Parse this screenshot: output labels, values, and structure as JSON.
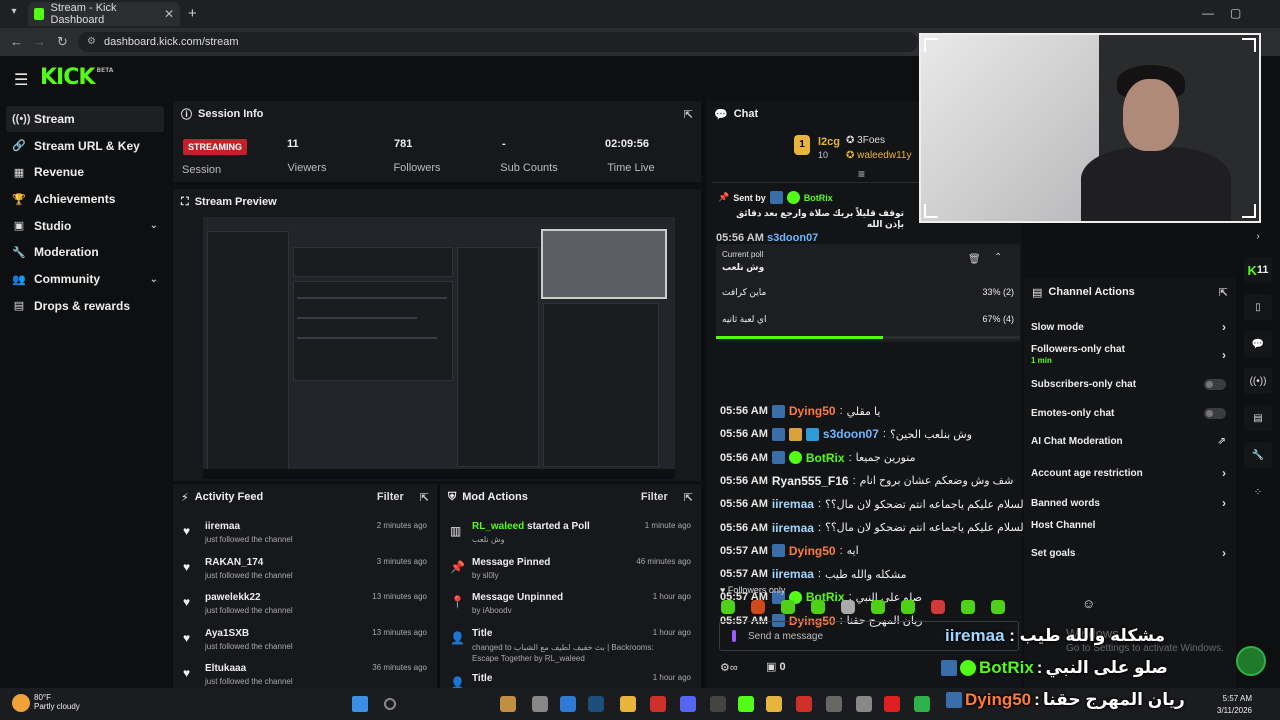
{
  "browser": {
    "tab_title": "Stream - Kick Dashboard",
    "url": "dashboard.kick.com/stream"
  },
  "app": {
    "logo": "KICK",
    "logo_tag": "BETA"
  },
  "sidebar": {
    "items": [
      {
        "label": "Stream",
        "icon": "signal-icon"
      },
      {
        "label": "Stream URL & Key",
        "icon": "link-icon"
      },
      {
        "label": "Revenue",
        "icon": "revenue-icon"
      },
      {
        "label": "Achievements",
        "icon": "trophy-icon"
      },
      {
        "label": "Studio",
        "icon": "studio-icon"
      },
      {
        "label": "Moderation",
        "icon": "wrench-icon"
      },
      {
        "label": "Community",
        "icon": "people-icon"
      },
      {
        "label": "Drops & rewards",
        "icon": "drops-icon"
      }
    ]
  },
  "session": {
    "title": "Session Info",
    "status_badge": "STREAMING",
    "session_label": "Session",
    "viewers": "11",
    "viewers_label": "Viewers",
    "followers": "781",
    "followers_label": "Followers",
    "subs": "-",
    "subs_label": "Sub Counts",
    "time_live": "02:09:56",
    "time_live_label": "Time Live"
  },
  "preview": {
    "title": "Stream Preview"
  },
  "activity": {
    "title": "Activity Feed",
    "filter": "Filter",
    "items": [
      {
        "user": "iiremaa",
        "action": "just followed the channel",
        "time": "2 minutes ago"
      },
      {
        "user": "RAKAN_174",
        "action": "just followed the channel",
        "time": "3 minutes ago"
      },
      {
        "user": "pawelekk22",
        "action": "just followed the channel",
        "time": "13 minutes ago"
      },
      {
        "user": "Aya1SXB",
        "action": "just followed the channel",
        "time": "13 minutes ago"
      },
      {
        "user": "Eltukaaa",
        "action": "just followed the channel",
        "time": "36 minutes ago"
      }
    ]
  },
  "mod": {
    "title": "Mod Actions",
    "filter": "Filter",
    "items": [
      {
        "title_user": "RL_waleed",
        "title_rest": "started a Poll",
        "sub": "وش نلعب",
        "time": "1 minute ago"
      },
      {
        "title_user": "",
        "title_rest": "Message Pinned",
        "sub": "by sl0ly",
        "time": "46 minutes ago"
      },
      {
        "title_user": "",
        "title_rest": "Message Unpinned",
        "sub": "by iAboodv",
        "time": "1 hour ago"
      },
      {
        "title_user": "",
        "title_rest": "Title",
        "sub": "changed to بث خفيف لطيف مع الشباب | Backrooms: Escape Together by RL_waleed",
        "time": "1 hour ago"
      },
      {
        "title_user": "",
        "title_rest": "Title",
        "sub": "",
        "time": "1 hour ago"
      }
    ]
  },
  "chat": {
    "title": "Chat",
    "top": {
      "user1": "l2cg",
      "count1": "10",
      "user2": "3Foes",
      "user3": "waleedw11y"
    },
    "pinned": {
      "sent_by_label": "Sent by",
      "sender": "BotRix",
      "text": "توقف قليلاً بريك صلاة وارجع بعد دقائق بإذن الله"
    },
    "partial_row": {
      "time": "05:56 AM",
      "user": "s3doon07"
    },
    "poll": {
      "label": "Current poll",
      "question": "وش نلعب",
      "options": [
        {
          "text": "ماين كرافت",
          "pct": "33% (2)",
          "share": 0.33
        },
        {
          "text": "اي لعبة ثانيه",
          "pct": "67% (4)",
          "share": 0.67
        }
      ],
      "progress": 0.55
    },
    "messages": [
      {
        "time": "05:56 AM",
        "user": "Dying50",
        "color": "#ff7b3a",
        "text": "يا مقلي"
      },
      {
        "time": "05:56 AM",
        "user": "s3doon07",
        "color": "#6fb6ff",
        "text": "وش بنلعب الحين؟"
      },
      {
        "time": "05:56 AM",
        "user": "BotRix",
        "color": "#53fc18",
        "text": "منورين جميعا"
      },
      {
        "time": "05:56 AM",
        "user": "Ryan555_F16",
        "color": "#eeeeee",
        "text": "شف وش وضعكم عشان بروح انام"
      },
      {
        "time": "05:56 AM",
        "user": "iiremaa",
        "color": "#9fd6ff",
        "text": "السلام عليكم ياجماعه انتم تضحكو لان مال؟؟"
      },
      {
        "time": "05:56 AM",
        "user": "iiremaa",
        "color": "#9fd6ff",
        "text": "السلام عليكم ياجماعه انتم تضحكو لان مال؟؟"
      },
      {
        "time": "05:57 AM",
        "user": "Dying50",
        "color": "#ff7b3a",
        "text": "ايه"
      },
      {
        "time": "05:57 AM",
        "user": "iiremaa",
        "color": "#9fd6ff",
        "text": "مشكله والله طيب"
      },
      {
        "time": "05:57 AM",
        "user": "BotRix",
        "color": "#53fc18",
        "text": "صلو على النبي"
      },
      {
        "time": "05:57 AM",
        "user": "Dying50",
        "color": "#ff7b3a",
        "text": "ريان المهرج حقنا"
      }
    ],
    "followers_only": "Followers only",
    "input_placeholder": "Send a message",
    "bottom_count": "0"
  },
  "channel_actions": {
    "title": "Channel Actions",
    "items": [
      {
        "label": "Slow mode",
        "sub": "",
        "control": "chevron"
      },
      {
        "label": "Followers-only chat",
        "sub": "1 min",
        "control": "chevron"
      },
      {
        "label": "Subscribers-only chat",
        "sub": "",
        "control": "toggle"
      },
      {
        "label": "Emotes-only chat",
        "sub": "",
        "control": "toggle"
      },
      {
        "label": "AI Chat Moderation",
        "sub": "",
        "control": "external"
      },
      {
        "label": "Account age restriction",
        "sub": "",
        "control": "chevron"
      },
      {
        "label": "Banned words",
        "sub": "",
        "control": "chevron"
      },
      {
        "label": "Host Channel",
        "sub": "",
        "control": "none"
      },
      {
        "label": "Set goals",
        "sub": "",
        "control": "chevron"
      }
    ]
  },
  "rail": {
    "kick_count": "11"
  },
  "overlay": {
    "lines": [
      {
        "user": "iiremaa",
        "text": "مشكله والله طيب"
      },
      {
        "user": "BotRix",
        "text": "صلو على النبي"
      },
      {
        "user": "Dying50",
        "text": "ريان المهرج حقنا"
      }
    ],
    "watermark1": "Windows",
    "watermark2": "Go to Settings to activate Windows."
  },
  "taskbar": {
    "temp": "80°F",
    "weather": "Partly cloudy",
    "time": "5:57 AM",
    "date": "3/11/2026"
  }
}
